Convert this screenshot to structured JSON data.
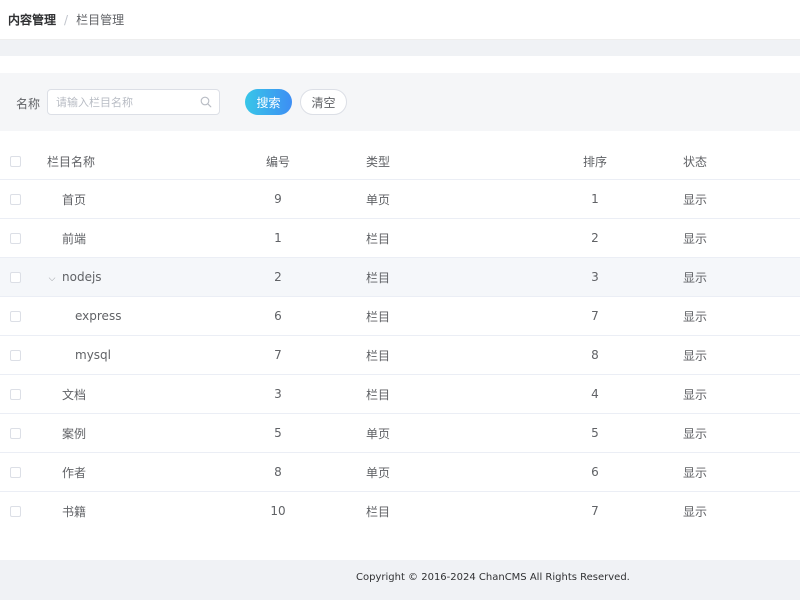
{
  "breadcrumb": {
    "parent": "内容管理",
    "separator": "/",
    "current": "栏目管理"
  },
  "search": {
    "label": "名称",
    "placeholder": "请输入栏目名称",
    "value": "",
    "search_button": "搜索",
    "clear_button": "清空",
    "search_icon": "search-icon"
  },
  "table": {
    "columns": {
      "name": "栏目名称",
      "id": "编号",
      "type": "类型",
      "sort": "排序",
      "status": "状态"
    },
    "rows": [
      {
        "name": "首页",
        "id": "9",
        "type": "单页",
        "sort": "1",
        "status": "显示",
        "level": 1,
        "expandable": false
      },
      {
        "name": "前端",
        "id": "1",
        "type": "栏目",
        "sort": "2",
        "status": "显示",
        "level": 1,
        "expandable": false
      },
      {
        "name": "nodejs",
        "id": "2",
        "type": "栏目",
        "sort": "3",
        "status": "显示",
        "level": 1,
        "expandable": true,
        "expanded": true
      },
      {
        "name": "express",
        "id": "6",
        "type": "栏目",
        "sort": "7",
        "status": "显示",
        "level": 2,
        "expandable": false
      },
      {
        "name": "mysql",
        "id": "7",
        "type": "栏目",
        "sort": "8",
        "status": "显示",
        "level": 2,
        "expandable": false
      },
      {
        "name": "文档",
        "id": "3",
        "type": "栏目",
        "sort": "4",
        "status": "显示",
        "level": 1,
        "expandable": false
      },
      {
        "name": "案例",
        "id": "5",
        "type": "单页",
        "sort": "5",
        "status": "显示",
        "level": 1,
        "expandable": false
      },
      {
        "name": "作者",
        "id": "8",
        "type": "单页",
        "sort": "6",
        "status": "显示",
        "level": 1,
        "expandable": false
      },
      {
        "name": "书籍",
        "id": "10",
        "type": "栏目",
        "sort": "7",
        "status": "显示",
        "level": 1,
        "expandable": false
      }
    ]
  },
  "footer": {
    "copyright": "Copyright © 2016-2024 ChanCMS All Rights Reserved."
  },
  "colors": {
    "accent_start": "#38c6e8",
    "accent_end": "#3d8ef4",
    "panel_bg": "#f5f6f8",
    "page_bg": "#f0f2f5"
  }
}
